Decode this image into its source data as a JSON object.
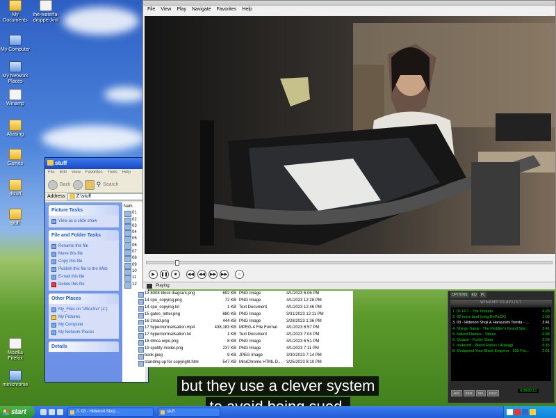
{
  "desktop": {
    "icons_left": [
      {
        "label": "My Documents",
        "kind": "folder"
      },
      {
        "label": "My Computer",
        "kind": "pc"
      },
      {
        "label": "My Network Places",
        "kind": "pc"
      },
      {
        "label": "Winamp",
        "kind": "doc"
      },
      {
        "label": "Aliasing",
        "kind": "folder"
      },
      {
        "label": "Games",
        "kind": "folder"
      },
      {
        "label": "dstuff",
        "kind": "folder"
      },
      {
        "label": "stuff",
        "kind": "folder"
      },
      {
        "label": "Mozilla Firefox",
        "kind": "doc"
      },
      {
        "label": "minichrome",
        "kind": "pc"
      }
    ],
    "icon_top_second": "the-waterfa-dropper.kml"
  },
  "explorer": {
    "title": "stuff",
    "menu": [
      "File",
      "Edit",
      "View",
      "Favorites",
      "Tools",
      "Help"
    ],
    "toolbar": {
      "back": "Back",
      "search": "Search"
    },
    "address_label": "Address",
    "address_value": "Z:\\stuff",
    "picture_tasks": {
      "title": "Picture Tasks",
      "items": [
        "View as a slide show"
      ]
    },
    "file_folder_tasks": {
      "title": "File and Folder Tasks",
      "items": [
        "Rename this file",
        "Move this file",
        "Copy this file",
        "Publish this file to the Web",
        "E-mail this file",
        "Delete this file"
      ]
    },
    "other_places": {
      "title": "Other Places",
      "items": [
        "My_Files on 'VBoxSvr' (Z:)",
        "My Pictures",
        "My Computer",
        "My Network Places"
      ]
    },
    "details_title": "Details",
    "file_col_header": "Nam",
    "file_col_rows": [
      "01",
      "02",
      "03",
      "04",
      "05",
      "06",
      "07",
      "08",
      "09",
      "10",
      "11",
      "12"
    ]
  },
  "file_list": [
    {
      "name": "13 8008 block diagram.png",
      "size": "692 KB",
      "type": "PNG Image",
      "date": "4/1/2023 6:06 PM"
    },
    {
      "name": "14 cpu_copying.png",
      "size": "72 KB",
      "type": "PNG Image",
      "date": "4/1/2023 12:28 PM"
    },
    {
      "name": "14 cpu_copying.txt",
      "size": "1 KB",
      "type": "Text Document",
      "date": "4/1/2023 12:46 PM"
    },
    {
      "name": "15 gates_letter.png",
      "size": "880 KB",
      "type": "PNG Image",
      "date": "3/31/2023 12:11 PM"
    },
    {
      "name": "16 2mad.png",
      "size": "444 KB",
      "type": "PNG Image",
      "date": "3/28/2023 1:36 PM"
    },
    {
      "name": "17 hypernormalisation.mp4",
      "size": "438,183 KB",
      "type": "MPEG-4 File Format",
      "date": "4/1/2023 6:57 PM"
    },
    {
      "name": "17 hypernormalisation.txt",
      "size": "1 KB",
      "type": "Text Document",
      "date": "4/1/2023 7:04 PM"
    },
    {
      "name": "18 dmca wipo.png",
      "size": "8 KB",
      "type": "PNG Image",
      "date": "4/1/2023 6:51 PM"
    },
    {
      "name": "19 spotify model.png",
      "size": "237 KB",
      "type": "PNG Image",
      "date": "4/1/2023 7:11 PM"
    },
    {
      "name": "book.jpeg",
      "size": "9 KB",
      "type": "JPEG Image",
      "date": "3/30/2023 7:14 PM"
    },
    {
      "name": "standing up for copyright.html",
      "size": "547 KB",
      "type": "MiniChrome HTML D...",
      "date": "3/25/2023 8:10 PM"
    }
  ],
  "player": {
    "menu": [
      "File",
      "View",
      "Play",
      "Navigate",
      "Favorites",
      "Help"
    ],
    "status": "Playing",
    "progress": 0.07
  },
  "winamp": {
    "top_buttons": [
      "OPTIONS",
      "EQ",
      "PL"
    ],
    "header": "WINAMP PLAYLIST",
    "playlist": [
      {
        "title": "1. 01 FF7 - The Prelude",
        "time": "4:28"
      },
      {
        "title": "2. 02 more land (omg RePaCK)",
        "time": "1:09"
      },
      {
        "title": "3. 03 - Hidenori Shoji & Haruyoshi Tomita - ...",
        "time": "3:41"
      },
      {
        "title": "4. Shingo Sakai - The Peddler's Grand Spe...",
        "time": "3:41"
      },
      {
        "title": "5. Naked Flames - Tobias",
        "time": "6:48"
      },
      {
        "title": "6. Quazar - Funky Stars",
        "time": "2:26"
      },
      {
        "title": "7. on4word - Weird Fishes / Arpeggi",
        "time": "5:15"
      },
      {
        "title": "8. Godspeed Your Black Emperor - 333 Fra...",
        "time": "2:51"
      }
    ],
    "selected_index": 2,
    "bottom_buttons": [
      "ADD",
      "REM",
      "SEL",
      "MISC"
    ],
    "time": "6:08/30:13"
  },
  "subtitles": [
    "but they use a clever system",
    "to avoid being sued."
  ],
  "taskbar": {
    "start": "start",
    "tasks": [
      "3. 03 - Hidenori Shoji ...",
      "stuff"
    ],
    "clock": ""
  }
}
